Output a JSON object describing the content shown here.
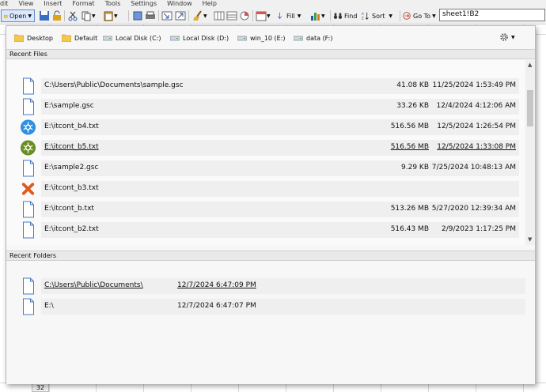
{
  "menu": [
    "dit",
    "View",
    "Insert",
    "Format",
    "Tools",
    "Settings",
    "Window",
    "Help"
  ],
  "toolbar": {
    "open_label": "Open",
    "fill_label": "Fill",
    "find_label": "Find",
    "sort_label": "Sort",
    "goto_label": "Go To",
    "cell_reference": "sheet1!B2"
  },
  "row_header": "32",
  "dialog": {
    "places": [
      {
        "label": "Desktop",
        "icon": "folder-icon"
      },
      {
        "label": "Default",
        "icon": "folder-icon"
      },
      {
        "label": "Local Disk (C:)",
        "icon": "drive-icon"
      },
      {
        "label": "Local Disk (D:)",
        "icon": "drive-icon"
      },
      {
        "label": "win_10 (E:)",
        "icon": "drive-icon"
      },
      {
        "label": "data (F:)",
        "icon": "drive-icon"
      }
    ],
    "recent_files_title": "Recent Files",
    "recent_folders_title": "Recent Folders",
    "files": [
      {
        "name": "C:\\Users\\Public\\Documents\\sample.gsc",
        "size": "41.08 KB",
        "date": "11/25/2024 1:53:49 PM",
        "icon": "document-icon"
      },
      {
        "name": "E:\\sample.gsc",
        "size": "33.26 KB",
        "date": "12/4/2024 4:12:06 AM",
        "icon": "document-icon"
      },
      {
        "name": "E:\\itcont_b4.txt",
        "size": "516.56 MB",
        "date": "12/5/2024 1:26:54 PM",
        "icon": "blue-molecule-icon"
      },
      {
        "name": "E:\\itcont_b5.txt",
        "size": "516.56 MB",
        "date": "12/5/2024 1:33:08 PM",
        "icon": "green-molecule-icon"
      },
      {
        "name": "E:\\sample2.gsc",
        "size": "9.29 KB",
        "date": "7/25/2024 10:48:13 AM",
        "icon": "document-icon"
      },
      {
        "name": "E:\\itcont_b3.txt",
        "size": "",
        "date": "",
        "icon": "missing-file-icon"
      },
      {
        "name": "E:\\itcont_b.txt",
        "size": "513.26 MB",
        "date": "5/27/2020 12:39:34 AM",
        "icon": "document-icon"
      },
      {
        "name": "E:\\itcont_b2.txt",
        "size": "516.43 MB",
        "date": "2/9/2023 1:17:25 PM",
        "icon": "document-icon"
      }
    ],
    "folders": [
      {
        "name": "C:\\Users\\Public\\Documents\\",
        "date": "12/7/2024 6:47:09 PM",
        "icon": "document-icon"
      },
      {
        "name": "E:\\",
        "date": "12/7/2024 6:47:07 PM",
        "icon": "document-icon"
      }
    ]
  }
}
